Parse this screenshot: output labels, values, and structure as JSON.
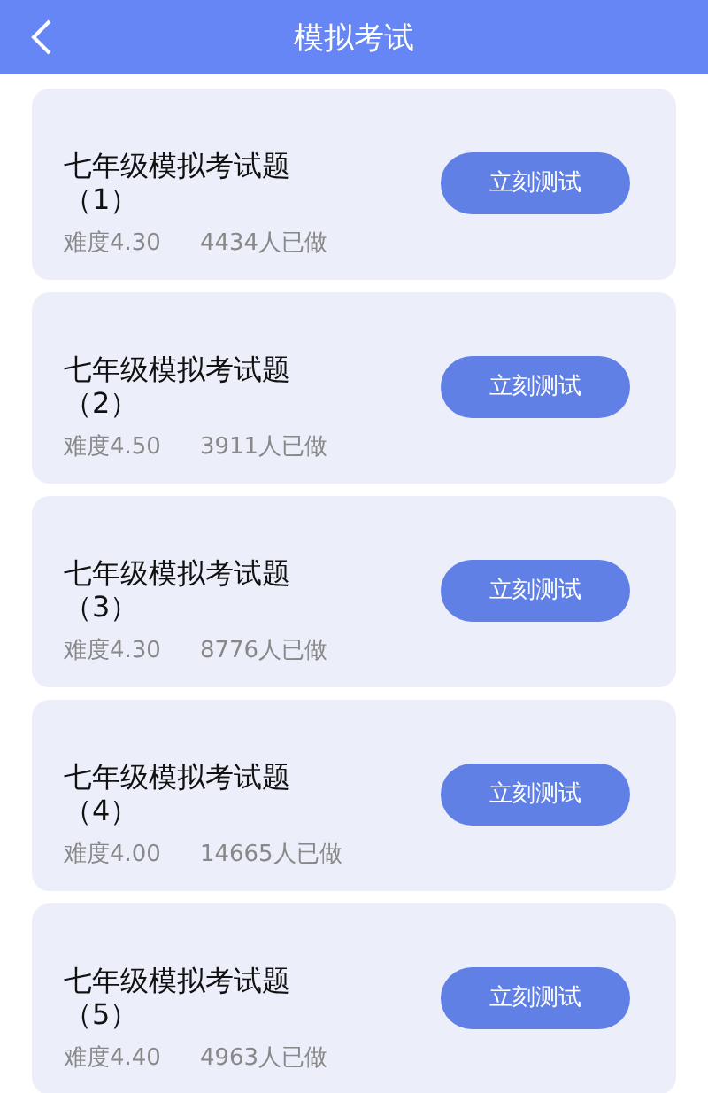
{
  "header": {
    "title": "模拟考试"
  },
  "exams": [
    {
      "title": "七年级模拟考试题（1）",
      "difficulty": "难度4.30",
      "count": "4434人已做",
      "button": "立刻测试"
    },
    {
      "title": "七年级模拟考试题（2）",
      "difficulty": "难度4.50",
      "count": "3911人已做",
      "button": "立刻测试"
    },
    {
      "title": "七年级模拟考试题（3）",
      "difficulty": "难度4.30",
      "count": "8776人已做",
      "button": "立刻测试"
    },
    {
      "title": "七年级模拟考试题（4）",
      "difficulty": "难度4.00",
      "count": "14665人已做",
      "button": "立刻测试"
    },
    {
      "title": "七年级模拟考试题（5）",
      "difficulty": "难度4.40",
      "count": "4963人已做",
      "button": "立刻测试"
    }
  ]
}
